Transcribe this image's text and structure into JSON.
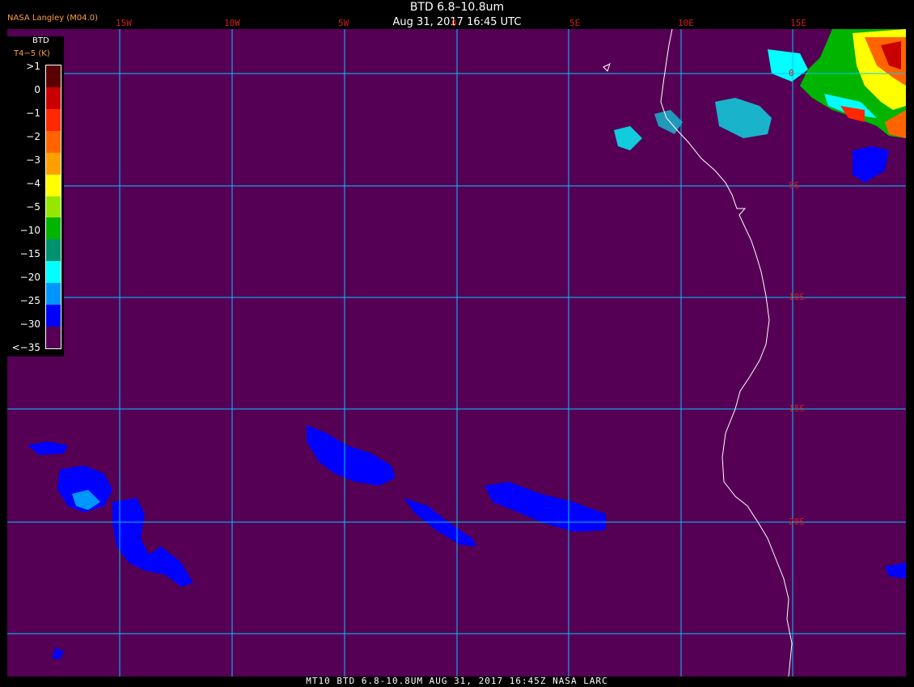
{
  "header": {
    "title": "BTD 6.8–10.8um",
    "date": "Aug 31, 2017 16:45 UTC",
    "org": "NASA Langley (M04.0)"
  },
  "legend": {
    "title": "BTD",
    "subtitle": "T4−5 (K)",
    "labels": [
      ">1",
      "0",
      "−1",
      "−2",
      "−3",
      "−4",
      "−5",
      "−10",
      "−15",
      "−20",
      "−25",
      "−30",
      "<−35"
    ],
    "colors": [
      "#5a0000",
      "#c80000",
      "#ff2800",
      "#ff6400",
      "#ffa000",
      "#ffff00",
      "#96e600",
      "#00b400",
      "#00916e",
      "#00ffff",
      "#0096ff",
      "#0000ff",
      "#550055"
    ]
  },
  "map": {
    "background_color": "#550055",
    "grid_color": "#00c8ff",
    "coast_color": "#ffffff",
    "lon_labels": [
      "15W",
      "10W",
      "5W",
      "0",
      "5E",
      "10E",
      "15E"
    ],
    "lat_labels": [
      "0",
      "5S",
      "10S",
      "15S",
      "20S"
    ]
  },
  "footer": {
    "text": "MT10  BTD 6.8-10.8UM   AUG 31, 2017 16:45Z   NASA LARC"
  }
}
